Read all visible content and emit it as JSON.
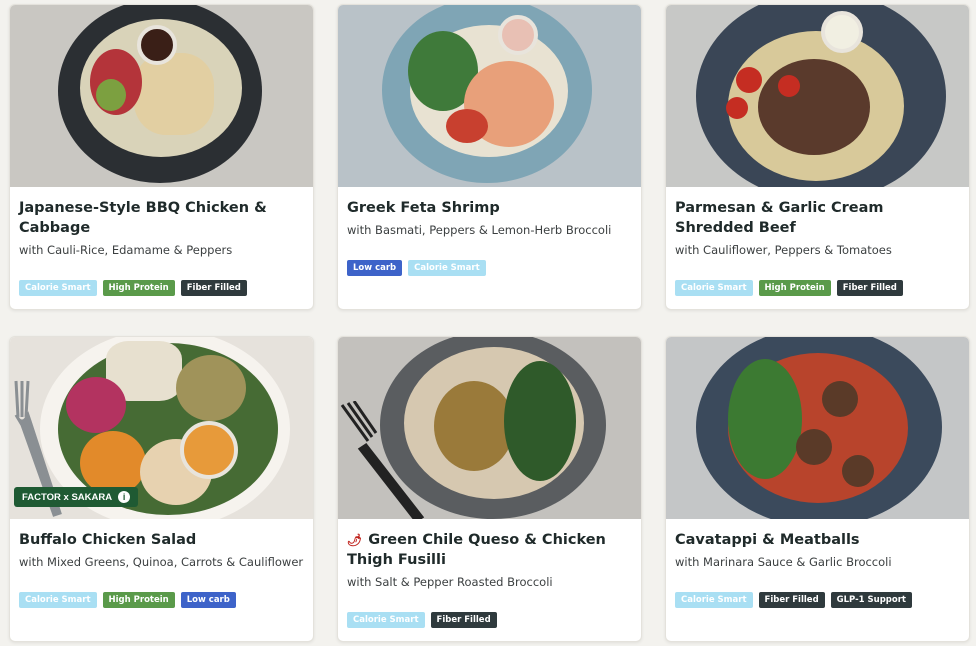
{
  "cards": [
    {
      "title": "Japanese-Style BBQ Chicken & Cabbage",
      "subtitle": "with Cauli-Rice, Edamame & Peppers",
      "tags": [
        "Calorie Smart",
        "High Protein",
        "Fiber Filled"
      ]
    },
    {
      "title": "Greek Feta Shrimp",
      "subtitle": "with Basmati, Peppers & Lemon-Herb Broccoli",
      "tags": [
        "Low carb",
        "Calorie Smart"
      ]
    },
    {
      "title": "Parmesan & Garlic Cream Shredded Beef",
      "subtitle": "with Cauliflower, Peppers & Tomatoes",
      "tags": [
        "Calorie Smart",
        "High Protein",
        "Fiber Filled"
      ]
    },
    {
      "title": "Buffalo Chicken Salad",
      "subtitle": "with Mixed Greens, Quinoa, Carrots & Cauliflower",
      "tags": [
        "Calorie Smart",
        "High Protein",
        "Low carb"
      ],
      "badge": "FACTOR x SAKARA",
      "badge_icon": "info-icon"
    },
    {
      "title": "Green Chile Queso & Chicken Thigh Fusilli",
      "subtitle": "with Salt & Pepper Roasted Broccoli",
      "tags": [
        "Calorie Smart",
        "Fiber Filled"
      ],
      "title_icon": "chili-pepper-icon"
    },
    {
      "title": "Cavatappi & Meatballs",
      "subtitle": "with Marinara Sauce & Garlic Broccoli",
      "tags": [
        "Calorie Smart",
        "Fiber Filled",
        "GLP-1 Support"
      ]
    }
  ],
  "tag_colors": {
    "calorie_smart": "#a9dff3",
    "high_protein": "#5a9a4a",
    "fiber_filled": "#2f3a3d",
    "low_carb": "#3d63c9",
    "glp1_support": "#2f3a3d"
  }
}
